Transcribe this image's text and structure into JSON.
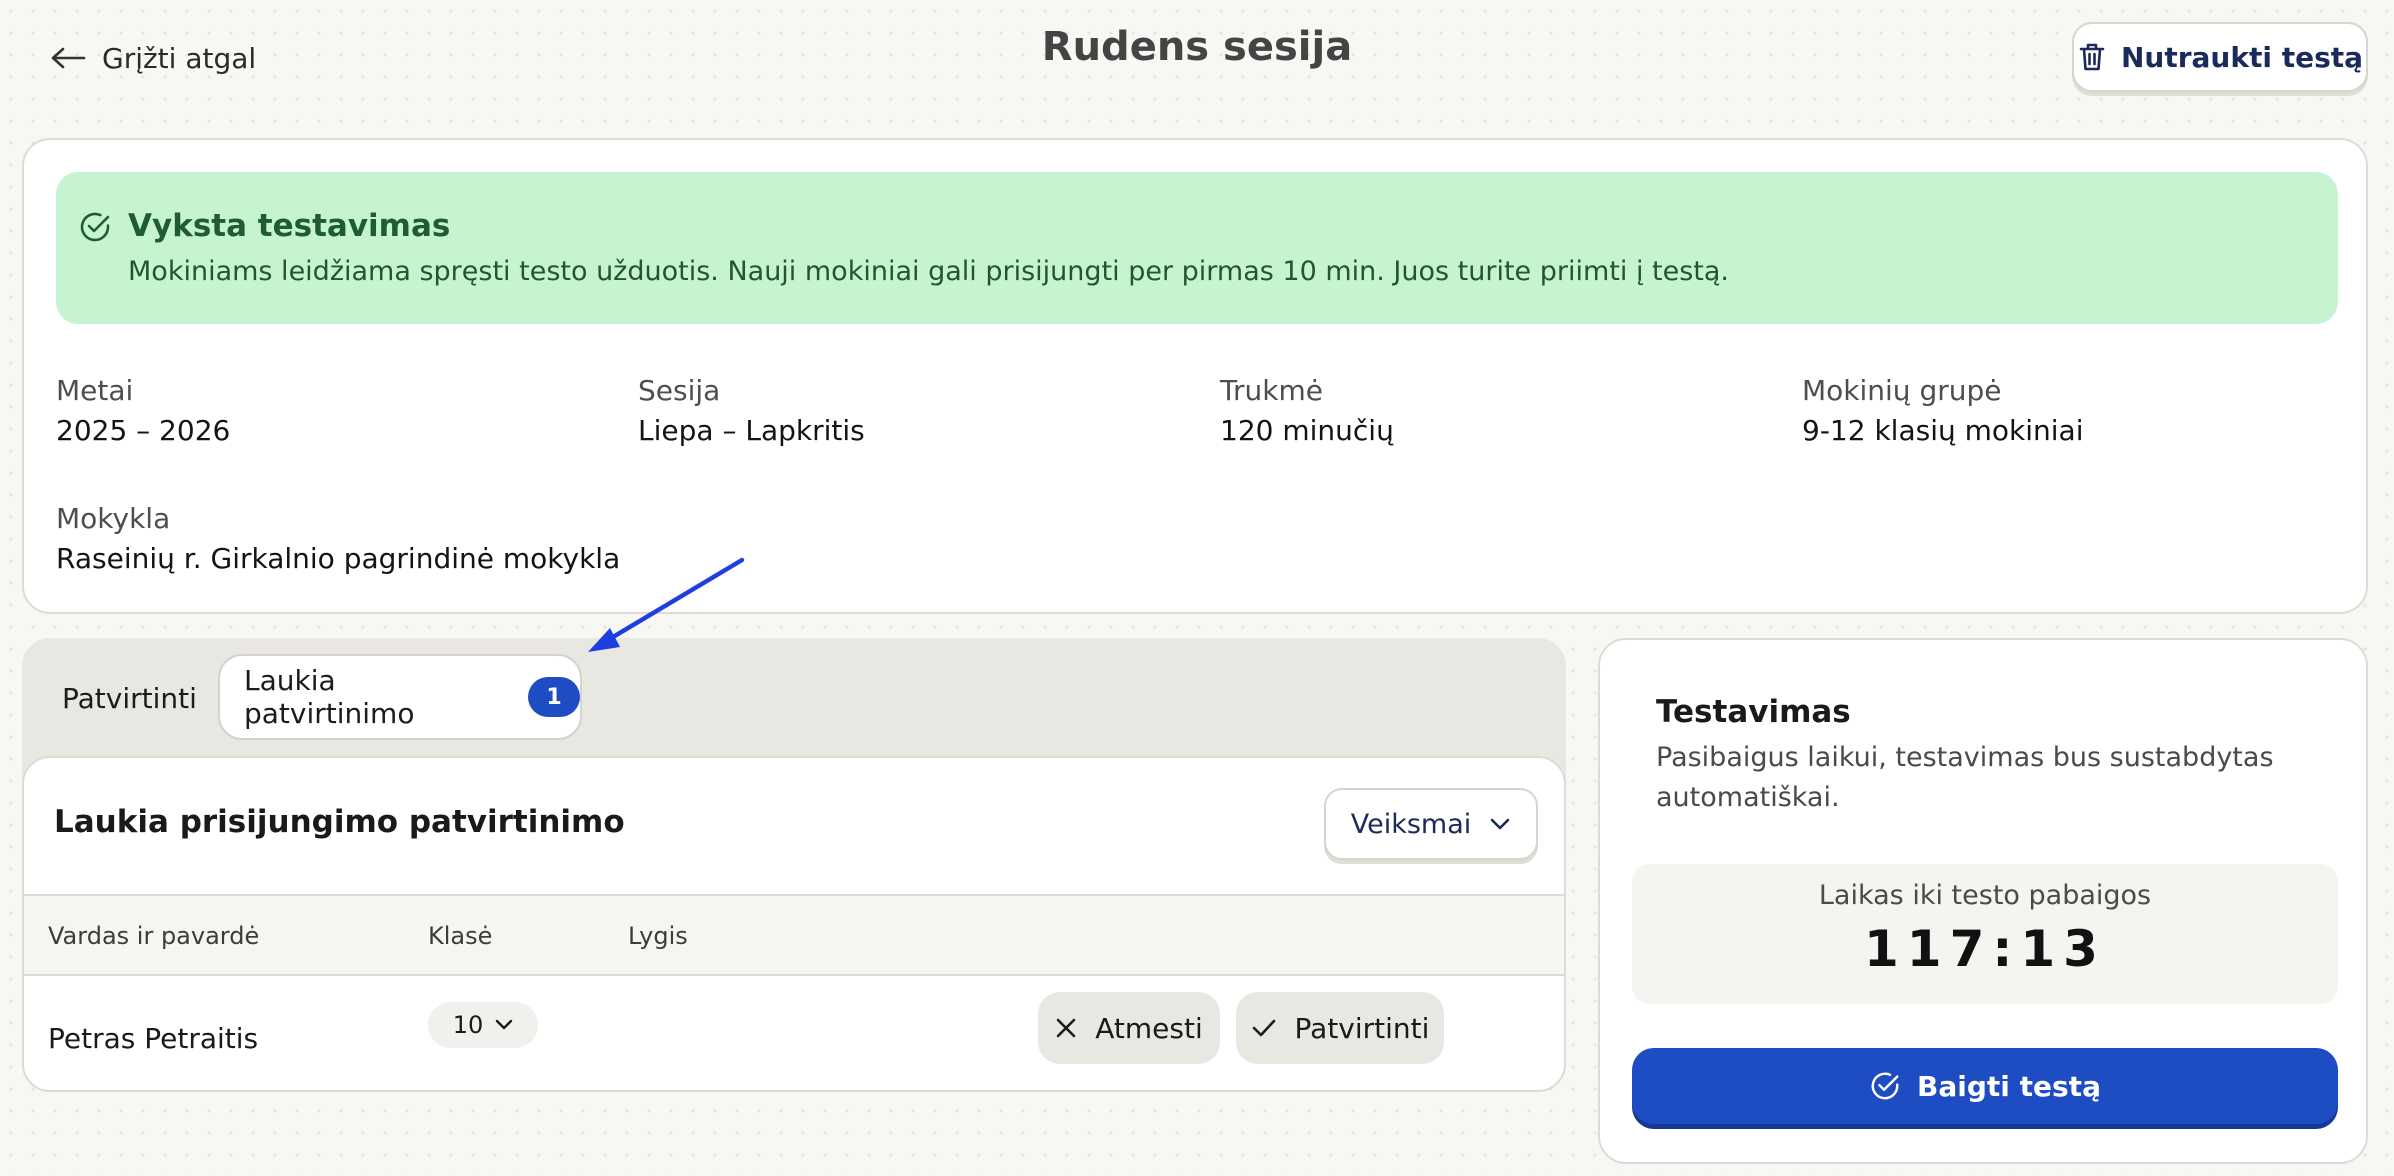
{
  "header": {
    "back_label": "Grįžti atgal",
    "title": "Rudens sesija",
    "abort_label": "Nutraukti testą"
  },
  "alert": {
    "title": "Vyksta testavimas",
    "text": "Mokiniams leidžiama spręsti testo užduotis. Nauji mokiniai gali prisijungti per pirmas 10 min. Juos turite priimti į testą."
  },
  "info": {
    "fields": [
      {
        "label": "Metai",
        "value": "2025 – 2026"
      },
      {
        "label": "Sesija",
        "value": "Liepa – Lapkritis"
      },
      {
        "label": "Trukmė",
        "value": "120 minučių"
      },
      {
        "label": "Mokinių grupė",
        "value": "9-12 klasių mokiniai"
      },
      {
        "label": "Mokykla",
        "value": "Raseinių r. Girkalnio pagrindinė mokykla"
      }
    ]
  },
  "tabs": {
    "approved_label": "Patvirtinti",
    "pending_label": "Laukia patvirtinimo",
    "pending_count": "1"
  },
  "table": {
    "title": "Laukia prisijungimo patvirtinimo",
    "actions_label": "Veiksmai",
    "columns": [
      "Vardas ir pavardė",
      "Klasė",
      "Lygis"
    ],
    "rows": [
      {
        "name": "Petras Petraitis",
        "grade": "10",
        "level": ""
      }
    ],
    "reject_label": "Atmesti",
    "approve_label": "Patvirtinti"
  },
  "test": {
    "title": "Testavimas",
    "description": "Pasibaigus laikui, testavimas bus sustabdytas automatiškai.",
    "timer_label": "Laikas iki testo pabaigos",
    "timer_value": "117:13",
    "finish_label": "Baigti testą"
  },
  "colors": {
    "accent": "#1e4cc3",
    "alert_bg": "#c6f4d1",
    "annotation_arrow": "#1f3ee0"
  },
  "icons": [
    "arrow-left-icon",
    "trash-icon",
    "check-circle-icon",
    "chevron-down-icon",
    "x-icon",
    "check-icon"
  ]
}
